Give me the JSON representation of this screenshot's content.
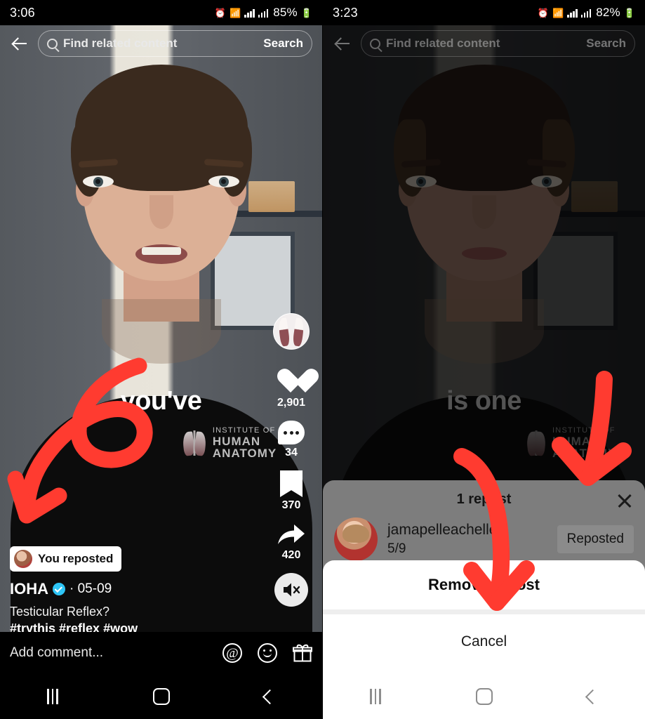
{
  "panels": [
    {
      "id": "left",
      "status": {
        "time": "3:06",
        "battery": "85%",
        "alarm_icon": "alarm-icon",
        "wifi_icon": "wifi-icon",
        "signal_icon": "signal-bars-icon"
      },
      "topbar": {
        "back_icon": "back-arrow-icon",
        "search_icon": "search-icon",
        "placeholder": "Find related content",
        "search_button": "Search"
      },
      "caption": "you've",
      "watermark": {
        "line1": "INSTITUTE OF",
        "line2": "HUMAN ANATOMY"
      },
      "rail": {
        "avatar_icon": "profile-avatar-icon",
        "like_icon": "heart-icon",
        "like_count": "2,901",
        "comment_icon": "comment-bubble-icon",
        "comment_count": "34",
        "bookmark_icon": "bookmark-icon",
        "bookmark_count": "370",
        "share_icon": "share-arrow-icon",
        "share_count": "420",
        "mute_icon": "speaker-muted-icon"
      },
      "meta": {
        "repost_badge": "You reposted",
        "repost_avatar_icon": "repost-user-avatar-icon",
        "author": "IOHA",
        "verified_icon": "verified-badge-icon",
        "separator": "·",
        "date": "05-09",
        "description": "Testicular Reflex?",
        "hashtags": "#trythis #reflex #wow"
      },
      "comment_bar": {
        "placeholder": "Add comment...",
        "mention_icon": "at-mention-icon",
        "emoji_icon": "emoji-smiley-icon",
        "gift_icon": "gift-icon"
      },
      "navbar": {
        "recents_icon": "android-recents-icon",
        "home_icon": "android-home-icon",
        "back_icon": "android-back-icon"
      }
    },
    {
      "id": "right",
      "status": {
        "time": "3:23",
        "battery": "82%",
        "alarm_icon": "alarm-icon",
        "wifi_icon": "wifi-icon",
        "signal_icon": "signal-bars-icon"
      },
      "topbar": {
        "back_icon": "back-arrow-icon",
        "search_icon": "search-icon",
        "placeholder": "Find related content",
        "search_button": "Search"
      },
      "caption": "is one",
      "watermark": {
        "line1": "INSTITUTE OF",
        "line2": "HUMAN ANATOMY"
      },
      "repost_sheet": {
        "title": "1 repost",
        "close_icon": "close-x-icon",
        "user": {
          "avatar_icon": "user-avatar-icon",
          "username": "jamapelleachelle",
          "date": "5/9",
          "button_label": "Reposted"
        }
      },
      "action_sheet": {
        "remove_label": "Remove repost",
        "cancel_label": "Cancel"
      },
      "navbar": {
        "recents_icon": "android-recents-icon",
        "home_icon": "android-home-icon",
        "back_icon": "android-back-icon"
      }
    }
  ],
  "annotations": {
    "color": "#ff3b30",
    "marks": [
      {
        "name": "arrow-to-repost-badge",
        "panel": "left",
        "points_to": "You reposted"
      },
      {
        "name": "arrow-to-remove-repost",
        "panel": "right",
        "points_to": "Remove repost"
      },
      {
        "name": "arrow-to-reposted-button",
        "panel": "right",
        "points_to": "Reposted"
      }
    ]
  }
}
